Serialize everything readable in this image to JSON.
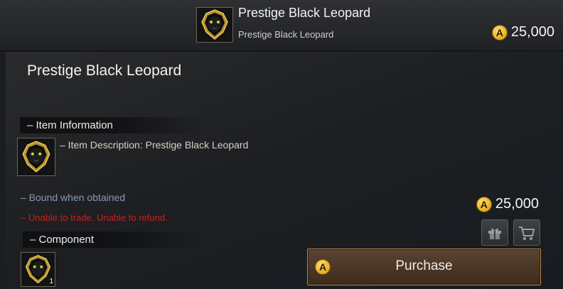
{
  "header": {
    "title": "Prestige Black Leopard",
    "subtitle": "Prestige Black Leopard",
    "currency_symbol": "A",
    "price": "25,000"
  },
  "item": {
    "name": "Prestige Black Leopard"
  },
  "sections": {
    "info_title": "– Item Information",
    "description": "– Item Description: Prestige Black Leopard",
    "bound": "– Bound when obtained",
    "warning": "– Unable to trade. Unable to refund.",
    "component_title": "– Component",
    "component_count": "1"
  },
  "purchase": {
    "currency_symbol": "A",
    "price": "25,000",
    "button_label": "Purchase"
  },
  "icons": {
    "item": "leopard-pendant-icon",
    "gift": "gift-icon",
    "cart": "cart-icon",
    "coin": "acoin-currency-icon"
  },
  "colors": {
    "warning": "#c8201e",
    "bound": "#8a9bb3",
    "coin": "#e4a91c",
    "purchase_border": "#b88a52"
  }
}
